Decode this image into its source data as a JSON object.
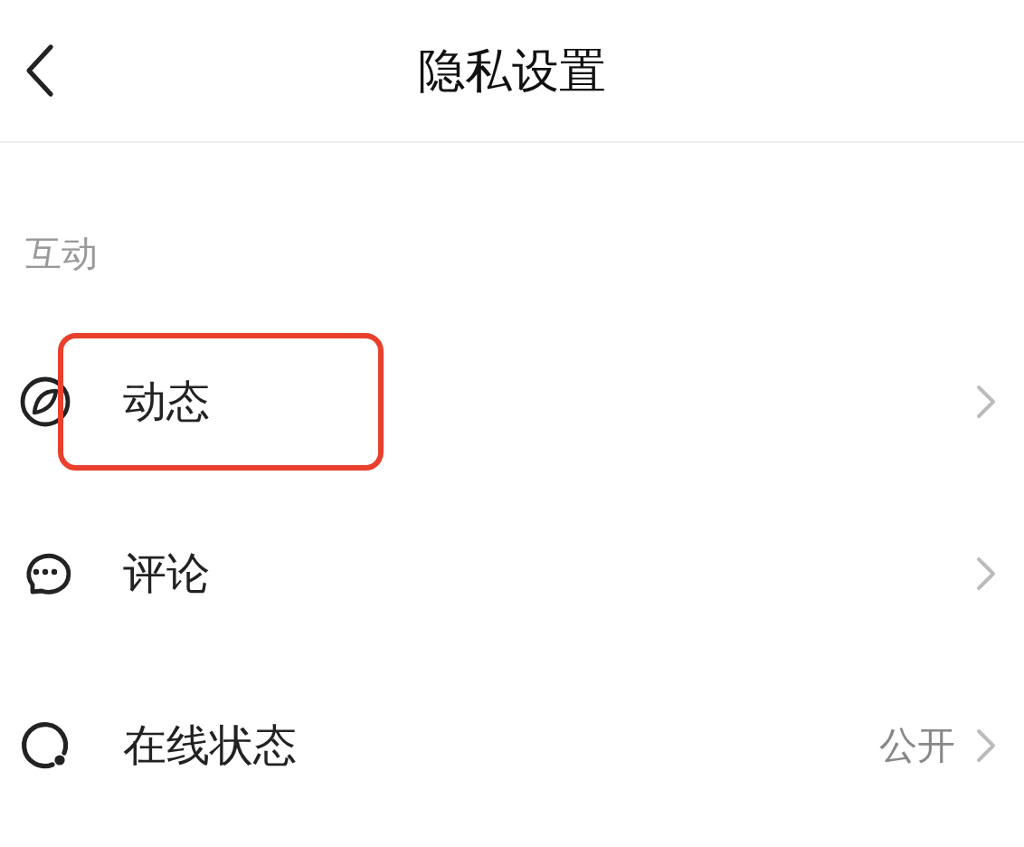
{
  "header": {
    "title": "隐私设置"
  },
  "section": {
    "label": "互动"
  },
  "rows": [
    {
      "kind": "feed",
      "label": "动态",
      "highlighted": true
    },
    {
      "kind": "comment",
      "label": "评论",
      "highlighted": false
    },
    {
      "kind": "status",
      "label": "在线状态",
      "value": "公开",
      "highlighted": false
    }
  ]
}
